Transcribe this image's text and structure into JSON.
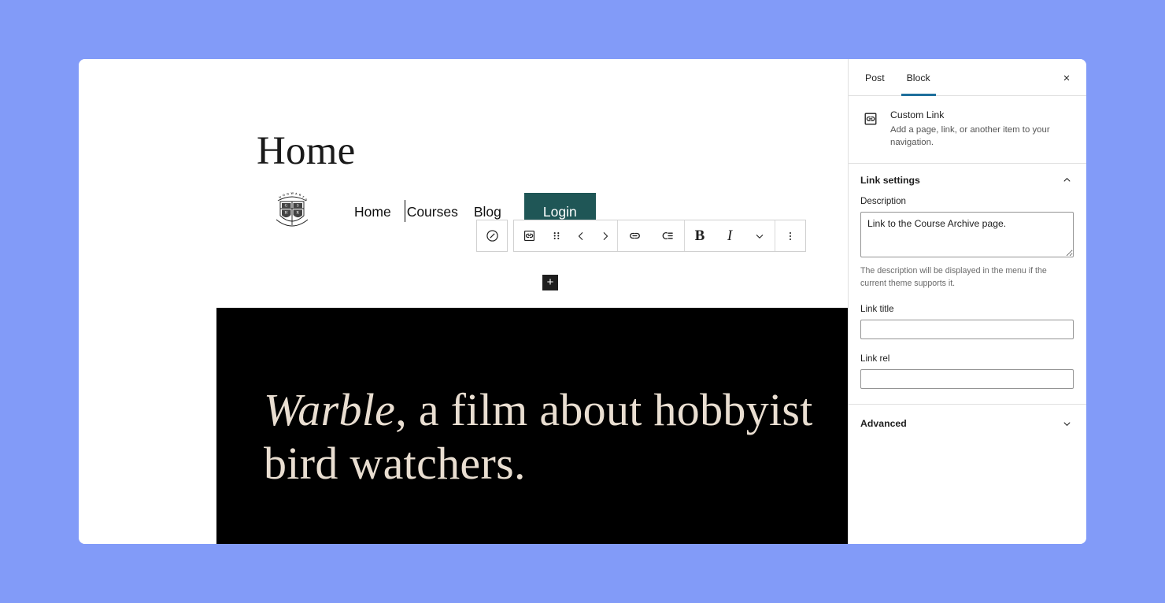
{
  "background_color": "#829bf8",
  "canvas": {
    "page_title": "Home",
    "site_logo_name": "hogwarts-crest-logo",
    "nav": {
      "items": [
        {
          "label": "Home",
          "style": "plain"
        },
        {
          "label": "Courses",
          "style": "plain-selected"
        },
        {
          "label": "Blog",
          "style": "plain"
        },
        {
          "label": "Login",
          "style": "button"
        }
      ],
      "appender_label": "+",
      "login_button_color": "#1f5656"
    },
    "hero": {
      "emphasis_text": "Warble",
      "rest_text": ", a film about hobbyist bird watchers.",
      "background_color": "#000000",
      "text_color": "#e9ded1"
    }
  },
  "block_toolbar": {
    "groups": [
      {
        "name": "parent-selector",
        "buttons": [
          {
            "name": "navigation-block-icon",
            "icon": "circle-slash-icon",
            "label": ""
          }
        ]
      },
      {
        "name": "block-controls",
        "buttons": [
          {
            "name": "custom-link-block-icon",
            "icon": "custom-link-icon",
            "label": ""
          },
          {
            "name": "drag-handle",
            "icon": "drag-dots-icon",
            "label": ""
          },
          {
            "name": "move-left",
            "icon": "chevron-left-icon",
            "label": ""
          },
          {
            "name": "move-right",
            "icon": "chevron-right-icon",
            "label": ""
          }
        ]
      },
      {
        "name": "link-controls",
        "buttons": [
          {
            "name": "link-button",
            "icon": "link-icon",
            "label": ""
          },
          {
            "name": "add-submenu-button",
            "icon": "submenu-icon",
            "label": ""
          }
        ]
      },
      {
        "name": "format-controls",
        "buttons": [
          {
            "name": "bold-button",
            "icon": "bold-glyph",
            "label": "B"
          },
          {
            "name": "italic-button",
            "icon": "italic-glyph",
            "label": "I"
          },
          {
            "name": "more-formats-button",
            "icon": "chevron-down-icon",
            "label": ""
          }
        ]
      },
      {
        "name": "options",
        "buttons": [
          {
            "name": "block-options-button",
            "icon": "vertical-dots-icon",
            "label": ""
          }
        ]
      }
    ]
  },
  "sidebar": {
    "tabs": [
      {
        "label": "Post",
        "active": false
      },
      {
        "label": "Block",
        "active": true
      }
    ],
    "active_tab_underline_color": "#1e6f9c",
    "close_label": "×",
    "block_card": {
      "icon_name": "custom-link-icon",
      "title": "Custom Link",
      "description": "Add a page, link, or another item to your navigation."
    },
    "sections": [
      {
        "name": "link-settings",
        "title": "Link settings",
        "expanded": true,
        "fields": [
          {
            "name": "description",
            "label": "Description",
            "type": "textarea",
            "value": "Link to the Course Archive page.",
            "placeholder": "",
            "help": "The description will be displayed in the menu if the current theme supports it."
          },
          {
            "name": "link-title",
            "label": "Link title",
            "type": "text",
            "value": "",
            "placeholder": ""
          },
          {
            "name": "link-rel",
            "label": "Link rel",
            "type": "text",
            "value": "",
            "placeholder": ""
          }
        ]
      },
      {
        "name": "advanced",
        "title": "Advanced",
        "expanded": false,
        "fields": []
      }
    ]
  }
}
